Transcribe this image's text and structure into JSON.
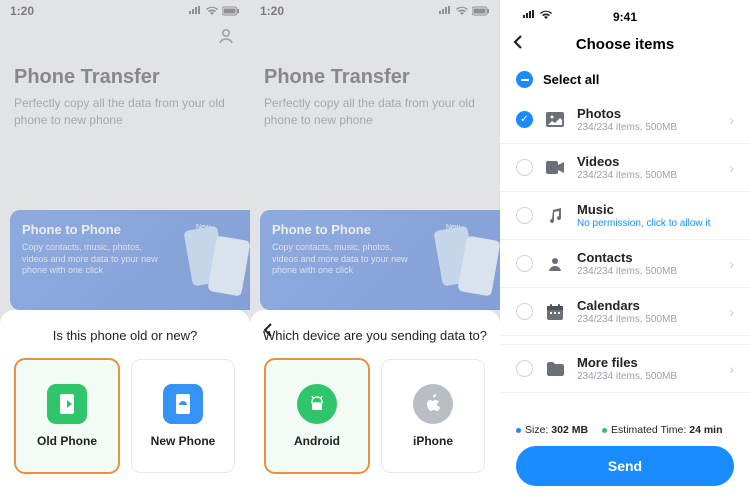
{
  "status_time": "1:20",
  "p3_time": "9:41",
  "app_title": "Phone Transfer",
  "app_sub": "Perfectly copy all the data from your old phone to new phone",
  "promo": {
    "title": "Phone to Phone",
    "desc": "Copy contacts, music, photos, videos and more data to your new phone with one click",
    "badge": "New"
  },
  "sheet1": {
    "question": "Is this phone old or new?",
    "opt_old": "Old Phone",
    "opt_new": "New Phone"
  },
  "sheet2": {
    "question": "Which device are you sending data to?",
    "opt_android": "Android",
    "opt_iphone": "iPhone"
  },
  "choose": {
    "title": "Choose items",
    "select_all": "Select all",
    "items": [
      {
        "name": "Photos",
        "detail": "234/234 items, 500MB",
        "checked": true
      },
      {
        "name": "Videos",
        "detail": "234/234 items, 500MB",
        "checked": false
      },
      {
        "name": "Music",
        "detail": "No permission,  click to allow it",
        "checked": false,
        "link": true
      },
      {
        "name": "Contacts",
        "detail": "234/234 items, 500MB",
        "checked": false
      },
      {
        "name": "Calendars",
        "detail": "234/234 items, 500MB",
        "checked": false
      }
    ],
    "more": {
      "name": "More files",
      "detail": "234/234 items, 500MB"
    },
    "size_label": "Size:",
    "size": "302 MB",
    "eta_label": "Estimated Time:",
    "eta": "24 min",
    "send": "Send"
  }
}
